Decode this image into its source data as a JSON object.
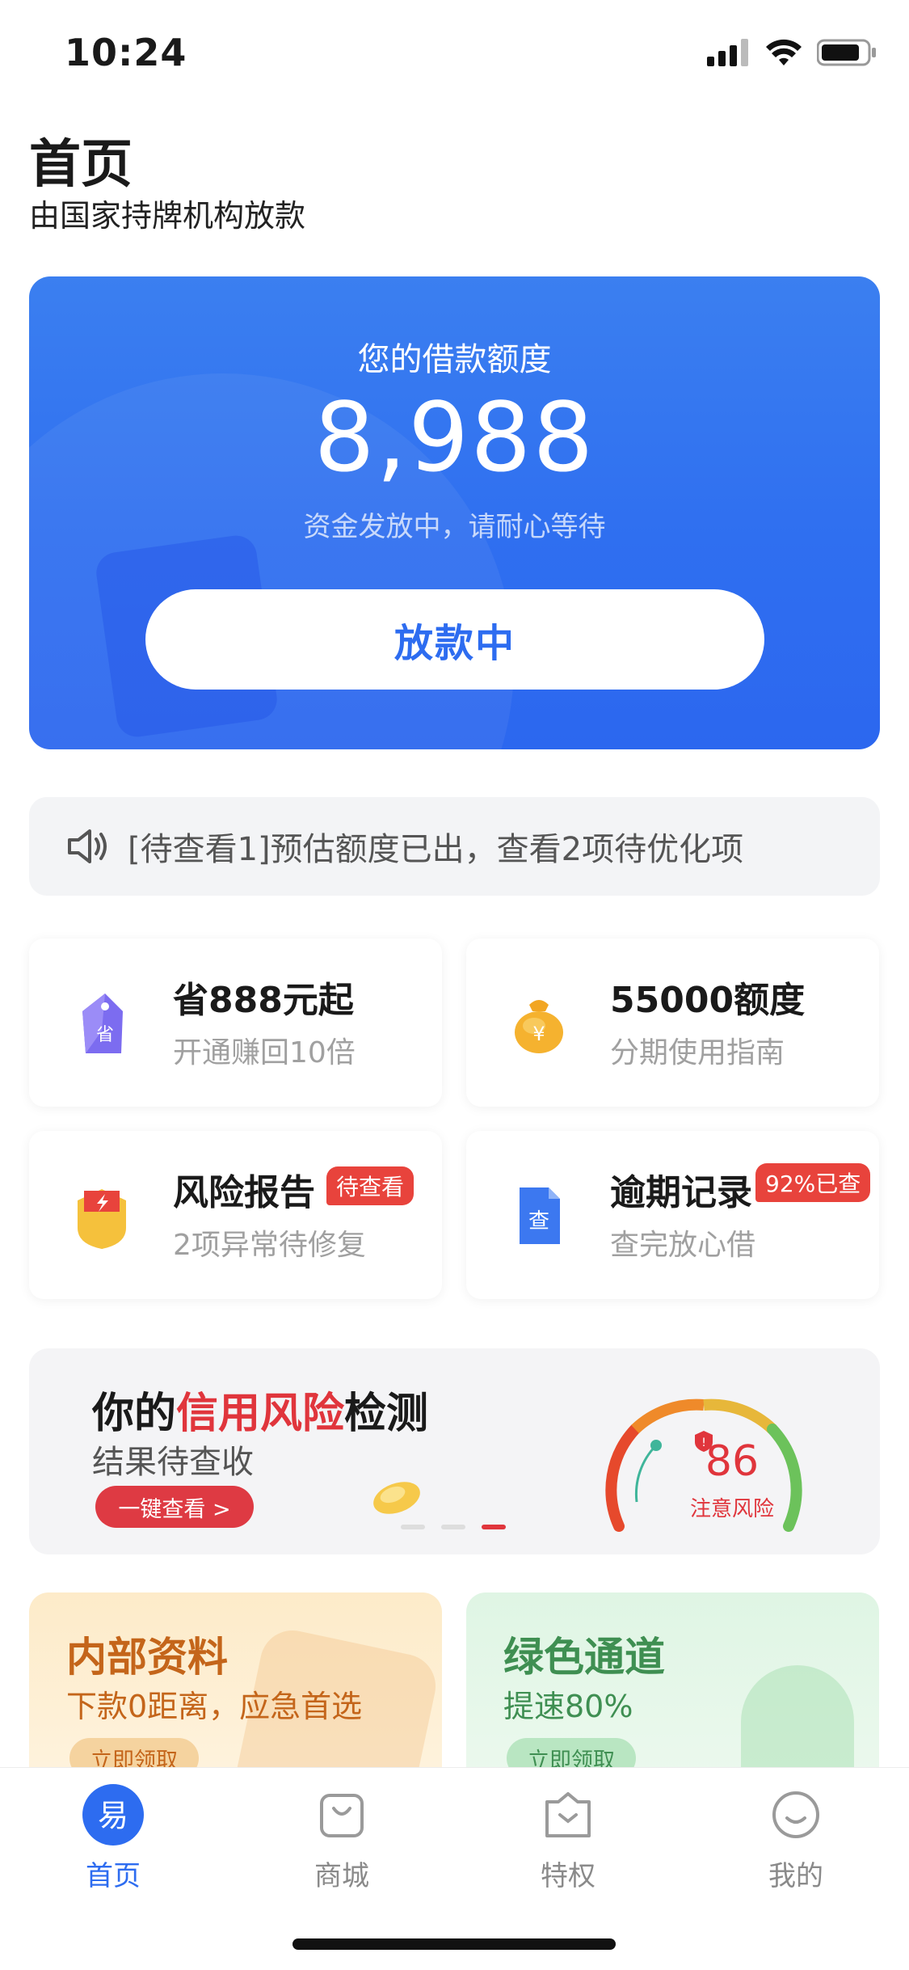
{
  "status_bar": {
    "time": "10:24"
  },
  "header": {
    "title": "首页",
    "subtitle": "由国家持牌机构放款"
  },
  "hero": {
    "label": "您的借款额度",
    "amount": "8,988",
    "note": "资金发放中，请耐心等待",
    "button_label": "放款中"
  },
  "notice": {
    "text": "[待查看1]预估额度已出，查看2项待优化项",
    "icon": "speaker-icon"
  },
  "tiles": [
    {
      "title": "省888元起",
      "subtitle": "开通赚回10倍",
      "icon": "savings-tag-icon",
      "badge": ""
    },
    {
      "title": "55000额度",
      "subtitle": "分期使用指南",
      "icon": "money-bag-icon",
      "badge": ""
    },
    {
      "title": "风险报告",
      "subtitle": "2项异常待修复",
      "icon": "risk-shield-icon",
      "badge": "待查看"
    },
    {
      "title": "逾期记录",
      "subtitle": "查完放心借",
      "icon": "document-check-icon",
      "badge": "92%已查"
    }
  ],
  "credit_banner": {
    "title_pre": "你的",
    "title_highlight": "信用风险",
    "title_post": "检测",
    "subtitle": "结果待查收",
    "button_label": "一键查看 >",
    "score": "86",
    "score_label": "注意风险",
    "carousel_active_index": 2
  },
  "promos": [
    {
      "title": "内部资料",
      "subtitle": "下款0距离，应急首选",
      "button_label": "立即领取"
    },
    {
      "title": "绿色通道",
      "subtitle": "提速80%",
      "button_label": "立即领取"
    }
  ],
  "tabbar": {
    "items": [
      {
        "label": "首页",
        "icon": "home-logo-icon",
        "active": true
      },
      {
        "label": "商城",
        "icon": "shopping-bag-icon",
        "active": false
      },
      {
        "label": "特权",
        "icon": "privilege-box-icon",
        "active": false
      },
      {
        "label": "我的",
        "icon": "smiley-profile-icon",
        "active": false
      }
    ]
  },
  "colors": {
    "brand_blue": "#2d6cf0",
    "alert_red": "#e0353c",
    "promo_orange": "#c4651a",
    "promo_green": "#3f8f52"
  }
}
